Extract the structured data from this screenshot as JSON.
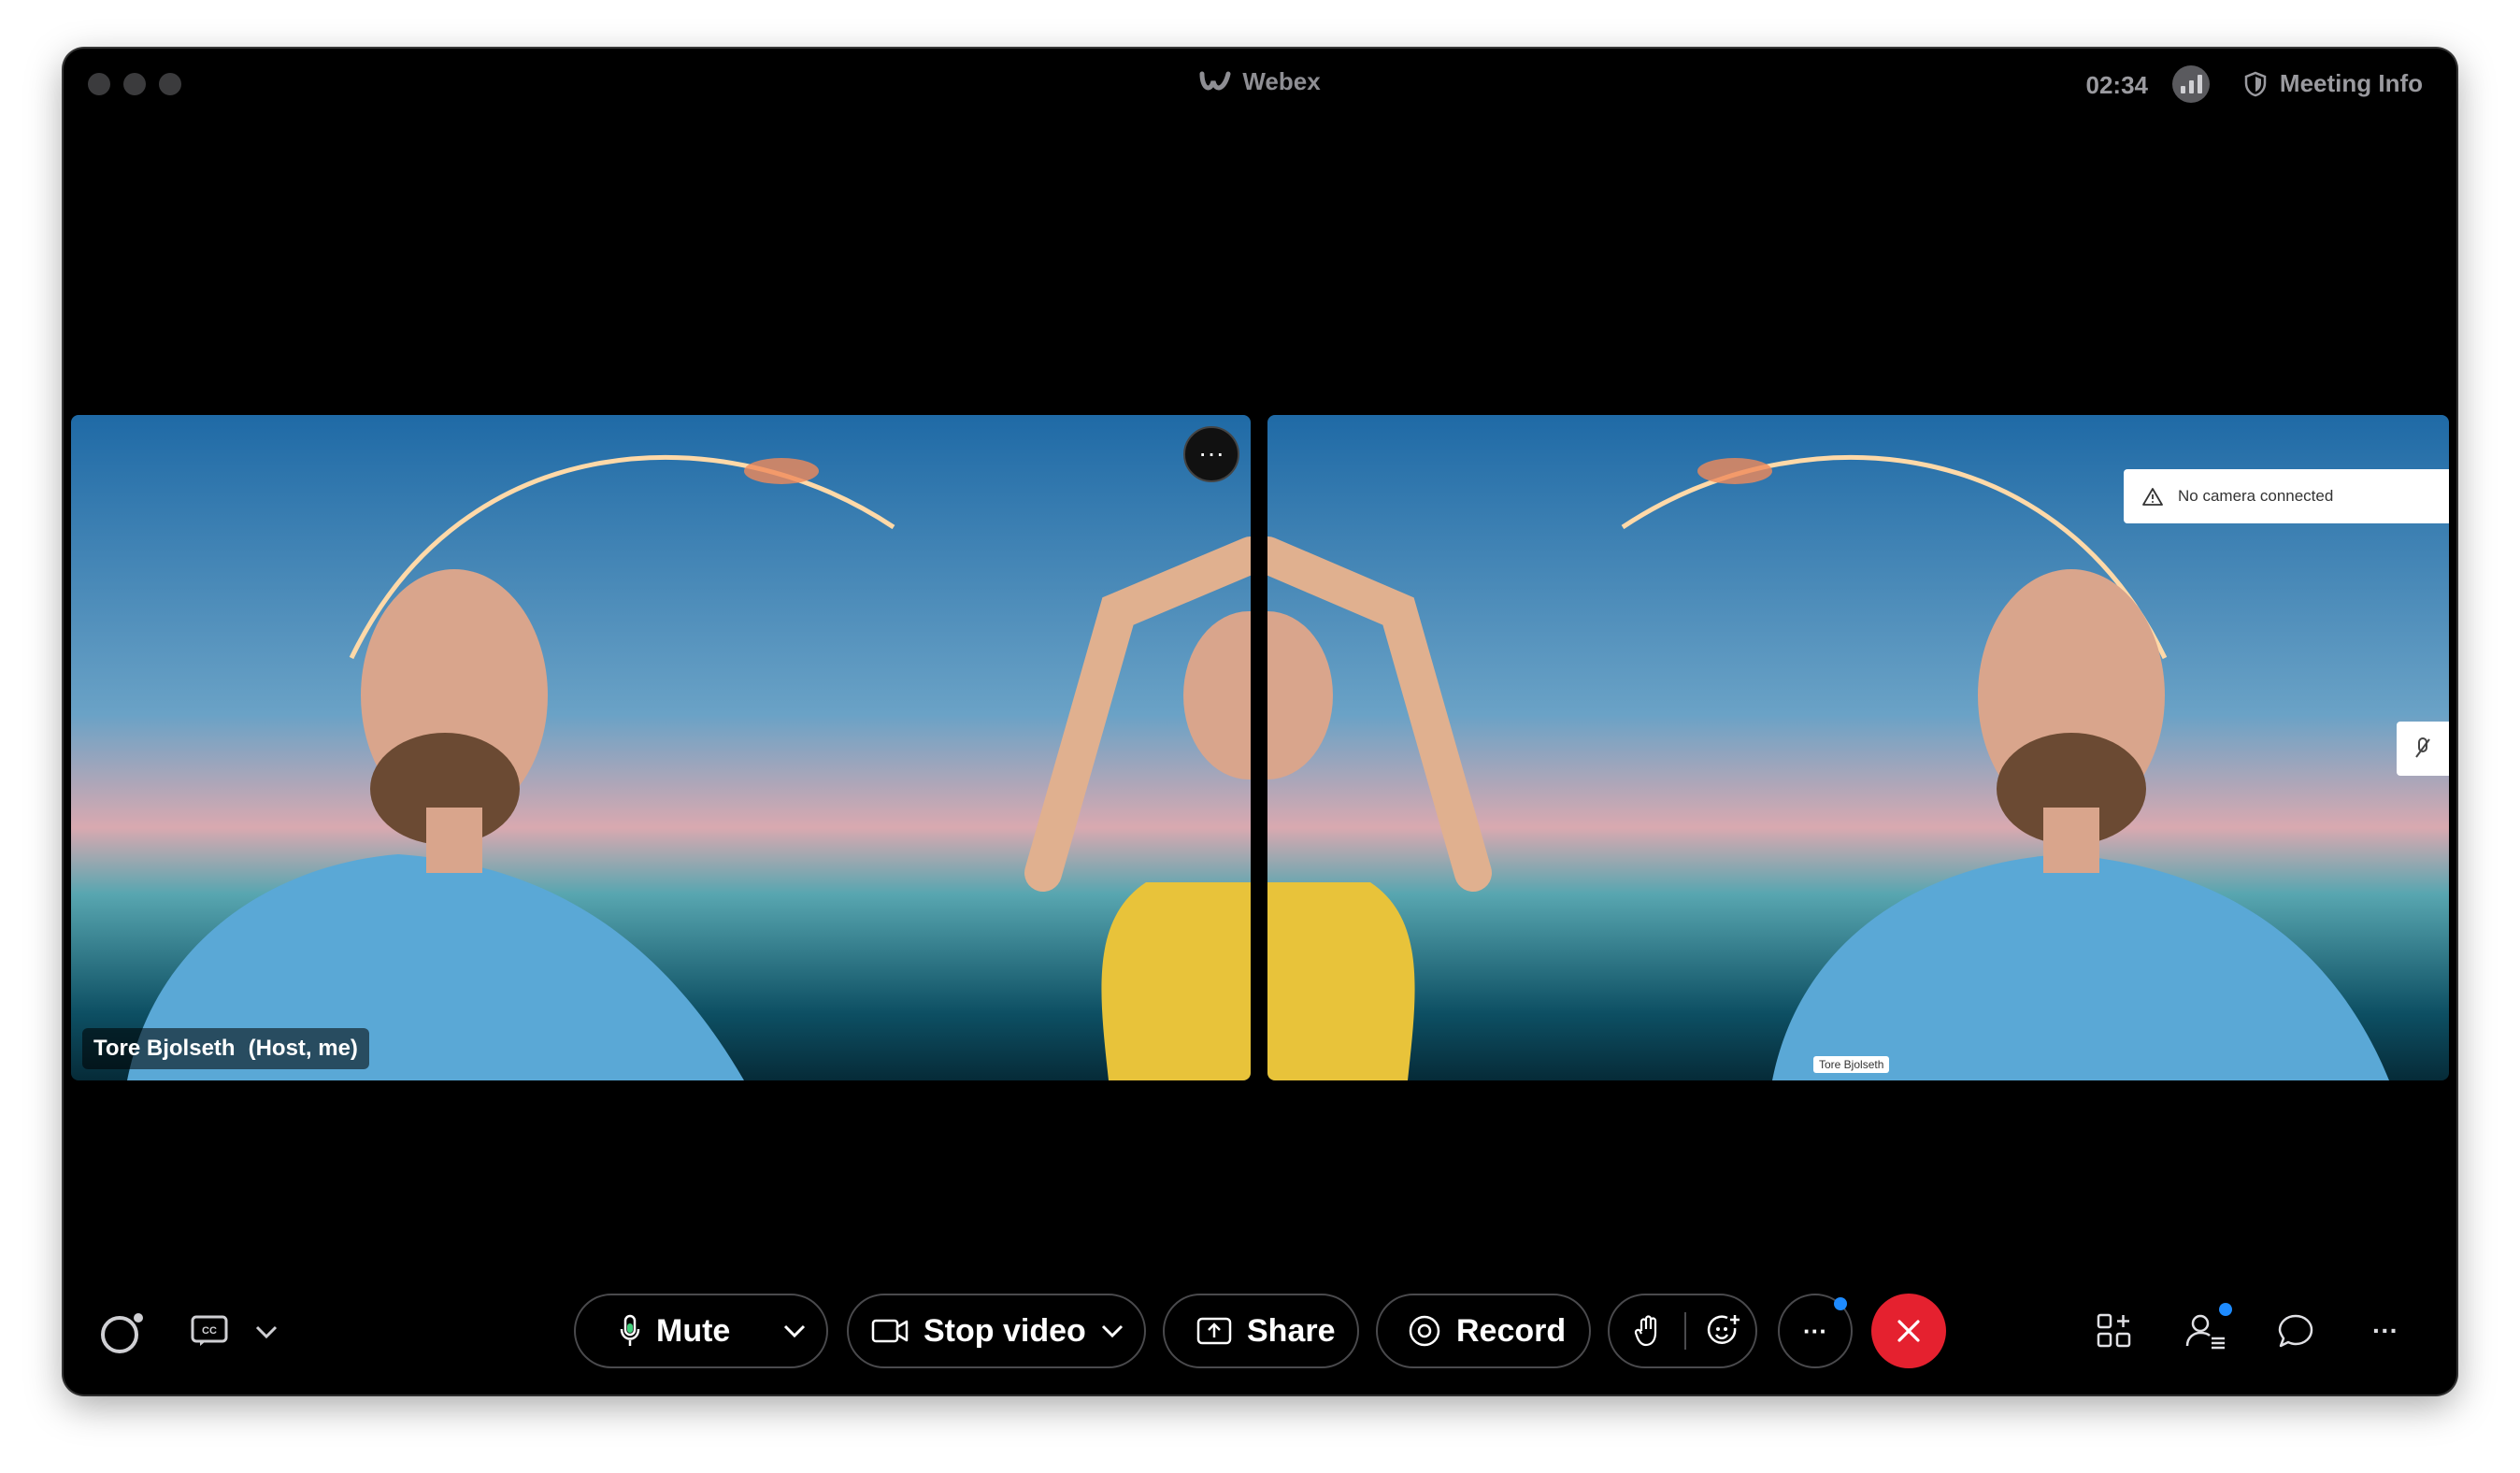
{
  "window": {
    "app_name": "Webex",
    "timer": "02:34",
    "meeting_info_label": "Meeting Info"
  },
  "tiles": {
    "left": {
      "participant_name": "Tore Bjolseth",
      "participant_role": "(Host, me)",
      "menu_label": "···"
    },
    "right": {
      "notice": "No camera connected",
      "name_tag": "Tore Bjolseth"
    }
  },
  "toolbar": {
    "mute_label": "Mute",
    "stop_video_label": "Stop video",
    "share_label": "Share",
    "record_label": "Record",
    "more_label": "···",
    "overflow_label": "···"
  },
  "colors": {
    "end_call": "#e5212f",
    "notification_dot": "#1e8bff",
    "shirt_yellow": "#e8c33a",
    "shirt_blue": "#5aa8d6"
  }
}
